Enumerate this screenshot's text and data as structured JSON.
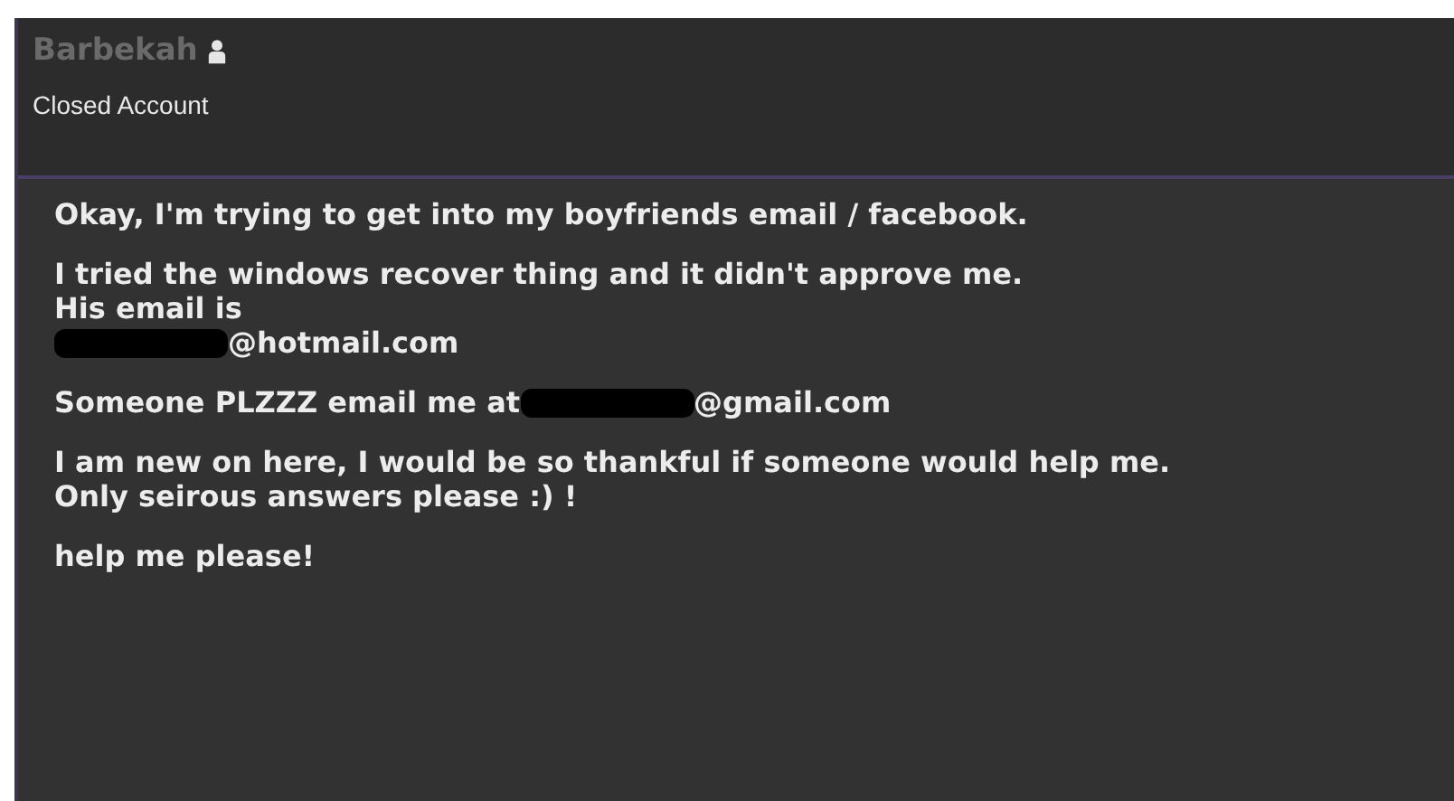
{
  "author": {
    "name": "Barbekah",
    "status": "Closed Account"
  },
  "post": {
    "paragraphs": [
      [
        [
          {
            "kind": "text",
            "text": "Okay, I'm trying to get into my boyfriends email / facebook."
          }
        ]
      ],
      [
        [
          {
            "kind": "text",
            "text": "I tried the windows recover thing and it didn't approve me."
          }
        ],
        [
          {
            "kind": "text",
            "text": "His email is"
          }
        ],
        [
          {
            "kind": "redaction"
          },
          {
            "kind": "text",
            "text": "@hotmail.com"
          }
        ]
      ],
      [
        [
          {
            "kind": "text",
            "text": "Someone PLZZZ email me at "
          },
          {
            "kind": "redaction"
          },
          {
            "kind": "text",
            "text": "@gmail.com"
          }
        ]
      ],
      [
        [
          {
            "kind": "text",
            "text": "I am new on here, I would be so thankful if someone would help me."
          }
        ],
        [
          {
            "kind": "text",
            "text": "Only seirous answers please :) !"
          }
        ]
      ],
      [
        [
          {
            "kind": "text",
            "text": "help me please!"
          }
        ]
      ]
    ]
  }
}
